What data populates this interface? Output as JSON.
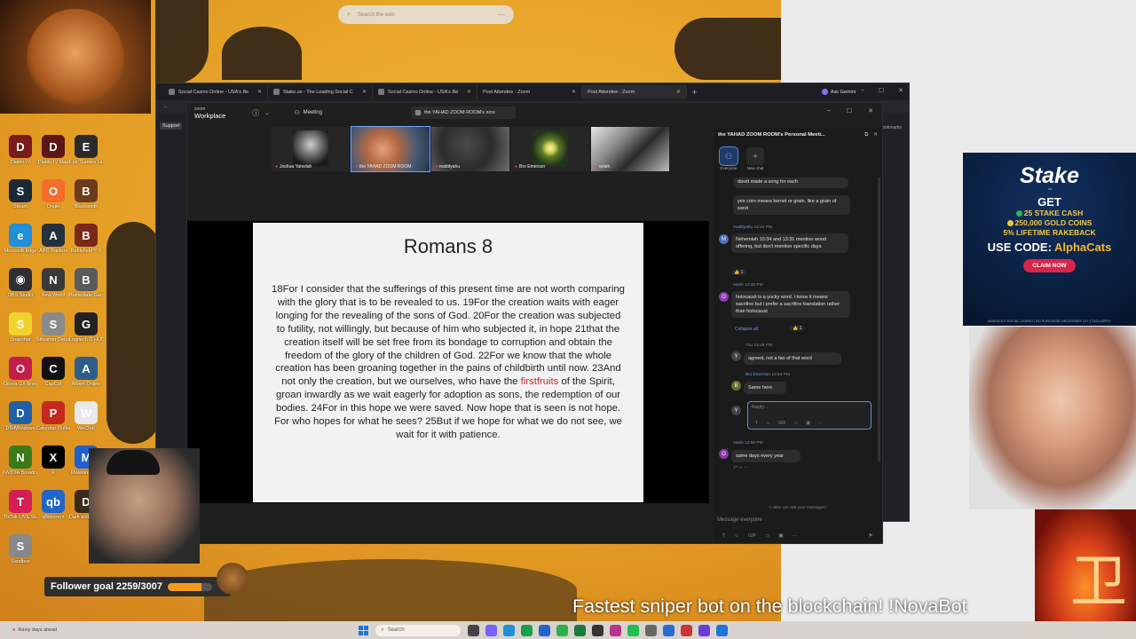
{
  "desktop": {
    "top_search_placeholder": "Search the web",
    "icons": [
      {
        "label": "Diablo IV",
        "color": "#7a1c1c",
        "glyph": "D"
      },
      {
        "label": "Diablo IV Map",
        "color": "#5c1616",
        "glyph": "D"
      },
      {
        "label": "Epic Games Launcher",
        "color": "#2b2b2b",
        "glyph": "E"
      },
      {
        "label": "Steam",
        "color": "#1b2838",
        "glyph": "S"
      },
      {
        "label": "Origin",
        "color": "#f56c2d",
        "glyph": "O"
      },
      {
        "label": "Blacksmith",
        "color": "#6b3b1b",
        "glyph": "B"
      },
      {
        "label": "Microsoft Edge",
        "color": "#1e8fd8",
        "glyph": "e"
      },
      {
        "label": "ARC Raiders",
        "color": "#24313e",
        "glyph": "A"
      },
      {
        "label": "Battlefield™ 6",
        "color": "#7a2a1a",
        "glyph": "B"
      },
      {
        "label": "OBS Studio",
        "color": "#302e31",
        "glyph": "◉"
      },
      {
        "label": "New World",
        "color": "#3a3a3a",
        "glyph": "N"
      },
      {
        "label": "Battlestate Games L...",
        "color": "#5a5a5a",
        "glyph": "B"
      },
      {
        "label": "Snapchat",
        "color": "#f2d32e",
        "glyph": "S"
      },
      {
        "label": "Streamer Deluxe",
        "color": "#8a8a8a",
        "glyph": "S"
      },
      {
        "label": "Logitech G HUB",
        "color": "#222",
        "glyph": "G"
      },
      {
        "label": "Opera GX Browser",
        "color": "#c21d4b",
        "glyph": "O"
      },
      {
        "label": "CapCut",
        "color": "#111",
        "glyph": "C"
      },
      {
        "label": "Albion Online",
        "color": "#2f5d8a",
        "glyph": "A"
      },
      {
        "label": "DS4Windows",
        "color": "#1e5fa8",
        "glyph": "D"
      },
      {
        "label": "Calendar Outlook",
        "color": "#c4291c",
        "glyph": "P"
      },
      {
        "label": "WeChat",
        "color": "#e9e9e9",
        "glyph": "W"
      },
      {
        "label": "NVIDIA Broadcast",
        "color": "#3a7a1a",
        "glyph": "N"
      },
      {
        "label": "X",
        "color": "#000",
        "glyph": "X"
      },
      {
        "label": "Malwarebytes",
        "color": "#1f5fd0",
        "glyph": "M"
      },
      {
        "label": "TikTok LIVE Studio",
        "color": "#d41e55",
        "glyph": "T"
      },
      {
        "label": "qBittorrent",
        "color": "#1e66c8",
        "glyph": "qb"
      },
      {
        "label": "Dark and Darker",
        "color": "#3a2a1a",
        "glyph": "D"
      },
      {
        "label": "Sandbox",
        "color": "#888",
        "glyph": "S"
      }
    ]
  },
  "browser": {
    "tabs": [
      {
        "label": "Social Casino Online - USA's Be",
        "zoom": false
      },
      {
        "label": "Stake.us - The Leading Social C",
        "zoom": false
      },
      {
        "label": "Social Casino Online - USA's Be",
        "zoom": false
      },
      {
        "label": "Post Attendee - Zoom",
        "zoom": true
      },
      {
        "label": "Post Attendee - Zoom",
        "zoom": true
      }
    ],
    "ask_gemini": "Ask Gemini",
    "support_label": "Support",
    "bookmarks_label": "Bookmarks"
  },
  "zoom": {
    "logo_top": "zoom",
    "logo_bottom": "Workplace",
    "meeting_label": "Meeting",
    "room_title": "the YAHAD ZOOM ROOM's scre",
    "participants": [
      {
        "name": "Joshua Yahsilah"
      },
      {
        "name": "the YAHAD ZOOM ROOM"
      },
      {
        "name": "mattityahu"
      },
      {
        "name": "Bro Emerson"
      },
      {
        "name": "onieh"
      }
    ],
    "slide": {
      "title": "Romans 8",
      "body_before": "18For I consider that the sufferings of this present time are not worth comparing with the glory that is to be revealed to us. 19For the creation waits with eager longing for the revealing of the sons of God. 20For the creation was subjected to futility, not willingly, but because of him who subjected it, in hope 21that the creation itself will be set free from its bondage to corruption and obtain the freedom of the glory of the children of God. 22For we know that the whole creation has been groaning together in the pains of childbirth until now. 23And not only the creation, but we ourselves, who have the ",
      "highlight": "firstfruits",
      "body_after": " of the Spirit, groan inwardly as we wait eagerly for adoption as sons, the redemption of our bodies. 24For in this hope we were saved. Now hope that is seen is not hope. For who hopes for what he sees? 25But if we hope for what we do not see, we wait for it with patience."
    },
    "chat": {
      "title": "the YAHAD ZOOM ROOM's Personal Meeti...",
      "tabs": [
        {
          "label": "Everyone"
        },
        {
          "label": "New chat"
        }
      ],
      "msg_top_partial": "david made a song for each",
      "msg1": "yes corn means kernel or grain. like a grain of sand",
      "msg2_name": "mattityahu",
      "msg2_time": "12:44 PM",
      "msg2": "Nehemiah 10:34 and 13:31 mention wood offering, but don't mention specific days",
      "msg2_react": "👍 1",
      "msg3_name": "onieh",
      "msg3_time": "12:48 PM",
      "msg3": "holocaust is a yucky word. i know it means sacrifice but i prefer a sacrifice translation rather than holocaust",
      "collapse_all": "Collapse all",
      "msg3_react": "👍 1",
      "you_name": "You",
      "you_time": "12:49 PM",
      "you_msg": "agreed,  not a fan of that word",
      "bro_name": "Bro Emerson",
      "bro_time": "12:54 PM",
      "bro_msg": "Same here",
      "reply_placeholder": "Reply...",
      "msg4_name": "onieh",
      "msg4_time": "12:56 PM",
      "msg4": "same days every year",
      "who_can_see": "Who can see your messages?",
      "message_placeholder": "Message everyone"
    }
  },
  "overlays": {
    "stake": {
      "logo": "Stake",
      "logo_sub": ".us",
      "get": "GET",
      "line1": "25 STAKE CASH",
      "line2": "250,000 GOLD COINS",
      "line3": "5% LIFETIME RAKEBACK",
      "code_prefix": "USE CODE: ",
      "code": "AlphaCats",
      "claim": "CLAIM NOW",
      "footer": "AMERICA'S SOCIAL CASINO | NO PURCHASE NECESSARY        21+ | T&Cs APPLY"
    },
    "follower_goal": "Follower goal 2259/3007",
    "follower_progress": 0.751,
    "ticker": "Fastest sniper bot on the blockchain! !NovaBot"
  },
  "taskbar": {
    "weather": "Rainy days ahead",
    "search_placeholder": "Search",
    "app_colors": [
      "#444444",
      "#7b61ff",
      "#1f8fd8",
      "#1a9e4a",
      "#1f66d1",
      "#2bb14b",
      "#1b7b3e",
      "#333333",
      "#b4358c",
      "#1dbf4f",
      "#666666",
      "#2b6bd1",
      "#c33",
      "#6e3bd1",
      "#1f73d8"
    ]
  }
}
